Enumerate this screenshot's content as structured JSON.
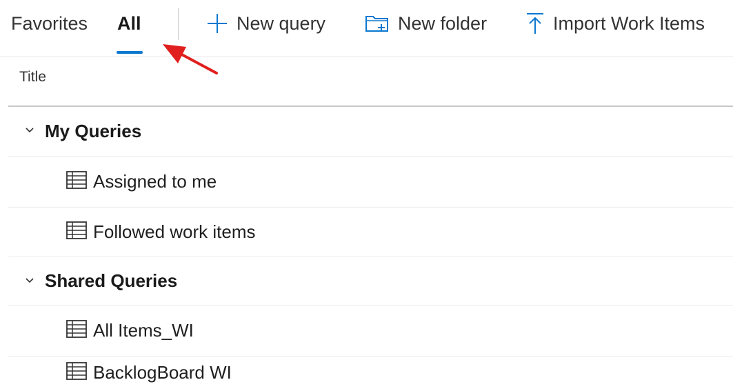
{
  "tabs": [
    {
      "label": "Favorites"
    },
    {
      "label": "All",
      "selected": true
    }
  ],
  "toolbar": {
    "new_query": "New query",
    "new_folder": "New folder",
    "import_work_items": "Import Work Items"
  },
  "icons": {
    "new_query": "plus-icon",
    "new_folder": "new-folder-icon",
    "import": "upload-arrow-icon",
    "query": "table-grid-icon",
    "expand": "chevron-down-icon",
    "annotation": "red-arrow-annotation"
  },
  "colors": {
    "accent": "#0b78d0",
    "annotation": "#e0201e"
  },
  "table": {
    "column_title": "Title"
  },
  "groups": [
    {
      "label": "My Queries",
      "expanded": true,
      "items": [
        {
          "label": "Assigned to me"
        },
        {
          "label": "Followed work items"
        }
      ]
    },
    {
      "label": "Shared Queries",
      "expanded": true,
      "items": [
        {
          "label": "All Items_WI"
        },
        {
          "label": "BacklogBoard WI"
        }
      ]
    }
  ]
}
